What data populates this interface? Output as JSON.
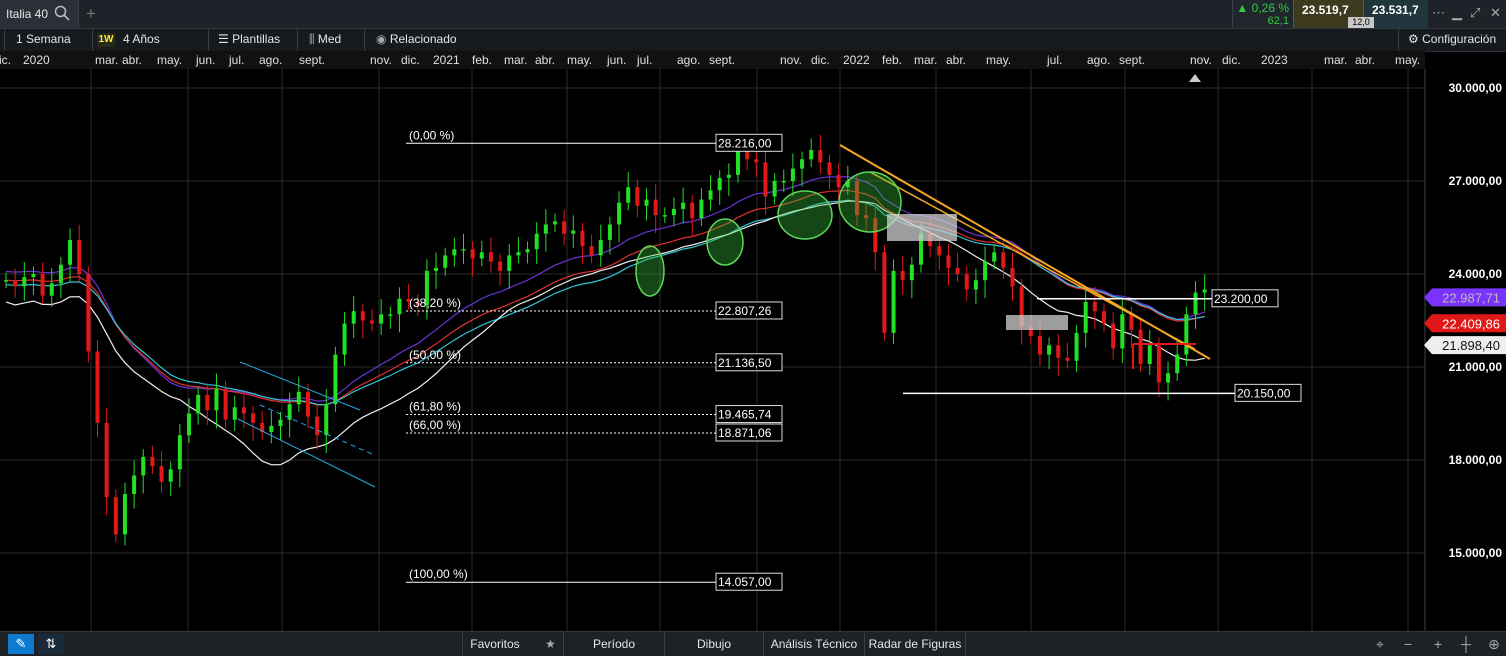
{
  "header": {
    "tab_title": "Italia 40",
    "change_pct": "0,26 %",
    "change_abs": "62,1",
    "bid": "23.519,7",
    "ask": "23.531,7",
    "spread": "12,0"
  },
  "toolbar": {
    "period": "1 Semana",
    "period_badge": "1W",
    "range": "4 Años",
    "templates": "Plantillas",
    "style": "Med",
    "related": "Relacionado",
    "settings": "Configuración"
  },
  "date_labels": [
    "ic.",
    "2020",
    "mar.",
    "abr.",
    "may.",
    "jun.",
    "jul.",
    "ago.",
    "sept.",
    "nov.",
    "dic.",
    "2021",
    "feb.",
    "mar.",
    "abr.",
    "may.",
    "jun.",
    "jul.",
    "ago.",
    "sept.",
    "nov.",
    "dic.",
    "2022",
    "feb.",
    "mar.",
    "abr.",
    "may.",
    "jul.",
    "ago.",
    "sept.",
    "nov.",
    "dic.",
    "2023",
    "mar.",
    "abr.",
    "may."
  ],
  "bottom": {
    "favorites": "Favoritos",
    "period": "Período",
    "drawing": "Dibujo",
    "technical": "Análisis Técnico",
    "patterns": "Radar de Figuras"
  },
  "colors": {
    "bull": "#22e022",
    "bear": "#e01818",
    "ma_purple": "#6b33d6",
    "ma_red": "#e03030",
    "ma_cyan": "#33c4d4",
    "ma_white": "#eeeeee",
    "trend_orange": "#f5a623",
    "channel_blue": "#2aa7e0",
    "fib_line": "#ffffff",
    "last_price_bg": "#e01818",
    "ma_label_bg": "#7a33ff"
  },
  "chart_data": {
    "type": "candlestick",
    "instrument": "Italia 40",
    "timeframe": "1 Semana",
    "ylim": [
      13200,
      31000
    ],
    "y_ticks": [
      "15.000,00",
      "18.000,00",
      "21.000,00",
      "24.000,00",
      "27.000,00",
      "30.000,00"
    ],
    "y_tick_values": [
      15000,
      18000,
      21000,
      24000,
      27000,
      30000
    ],
    "fibonacci": [
      {
        "pct": "(0,00 %)",
        "value": 28216.0,
        "label": "28.216,00"
      },
      {
        "pct": "(38,20 %)",
        "value": 22807.26,
        "label": "22.807,26"
      },
      {
        "pct": "(50,00 %)",
        "value": 21136.5,
        "label": "21.136,50"
      },
      {
        "pct": "(61,80 %)",
        "value": 19465.74,
        "label": "19.465,74"
      },
      {
        "pct": "(66,00 %)",
        "value": 18871.06,
        "label": "18.871,06"
      },
      {
        "pct": "(100,00 %)",
        "value": 14057.0,
        "label": "14.057,00"
      }
    ],
    "horizontal_levels": [
      {
        "value": 23200,
        "label": "23.200,00"
      },
      {
        "value": 20150,
        "label": "20.150,00"
      }
    ],
    "price_tags": [
      {
        "value": 22987.71,
        "label": "22.987,71",
        "kind": "ma"
      },
      {
        "value": 22409.86,
        "label": "22.409,86",
        "kind": "last"
      },
      {
        "value": 21898.4,
        "label": "21.898,40",
        "kind": "ma2"
      }
    ],
    "closes": [
      23800,
      23600,
      23900,
      24000,
      23300,
      23700,
      24300,
      25100,
      24000,
      21500,
      19200,
      16800,
      15600,
      16900,
      17500,
      18100,
      17800,
      17300,
      17700,
      18800,
      19500,
      20100,
      19600,
      20300,
      19300,
      19700,
      19500,
      19200,
      18900,
      19100,
      19300,
      19800,
      20200,
      19400,
      18800,
      19800,
      21400,
      22400,
      22800,
      22500,
      22400,
      22700,
      22700,
      23200,
      23100,
      23000,
      24100,
      24200,
      24600,
      24800,
      24800,
      24500,
      24700,
      24400,
      24100,
      24600,
      24700,
      24800,
      25300,
      25600,
      25700,
      25300,
      25400,
      24900,
      24600,
      25100,
      25600,
      26300,
      26800,
      26200,
      26400,
      25900,
      25900,
      26100,
      26300,
      25800,
      26400,
      26700,
      27100,
      27200,
      28000,
      27700,
      27600,
      26500,
      27000,
      27000,
      27400,
      27700,
      28000,
      27600,
      27200,
      26800,
      27000,
      25900,
      25800,
      24700,
      22100,
      24100,
      23800,
      24300,
      25300,
      24900,
      24600,
      24200,
      24000,
      23500,
      23800,
      24400,
      24700,
      24200,
      23600,
      22300,
      22000,
      21400,
      21700,
      21300,
      21200,
      22100,
      23100,
      22800,
      22400,
      21600,
      22700,
      22200,
      21100,
      21700,
      20500,
      20800,
      21400,
      22700,
      23400,
      23500
    ]
  }
}
